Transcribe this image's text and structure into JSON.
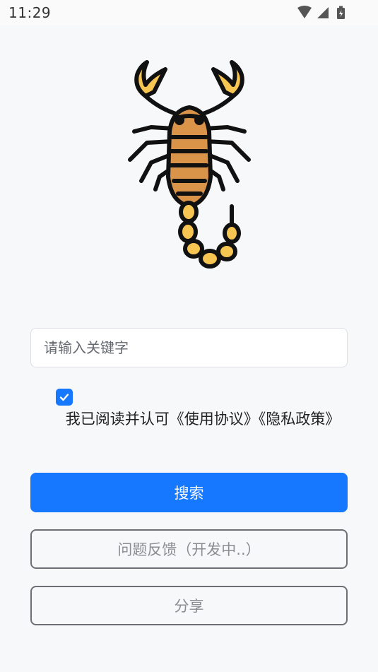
{
  "status_bar": {
    "time": "11:29",
    "icons": [
      "wifi-icon",
      "cell-signal-icon",
      "battery-charging-icon"
    ]
  },
  "logo": {
    "icon": "scorpion-icon"
  },
  "search": {
    "placeholder": "请输入关键字",
    "value": ""
  },
  "agreement": {
    "checked": true,
    "text": "我已阅读并认可《使用协议》《隐私政策》"
  },
  "buttons": {
    "search_label": "搜索",
    "feedback_label": "问题反馈（开发中..）",
    "share_label": "分享"
  },
  "colors": {
    "primary": "#1677ff",
    "background": "#f7f8fa",
    "scorpion_body": "#d9944a",
    "scorpion_tail": "#f6c552",
    "outline": "#111111"
  }
}
